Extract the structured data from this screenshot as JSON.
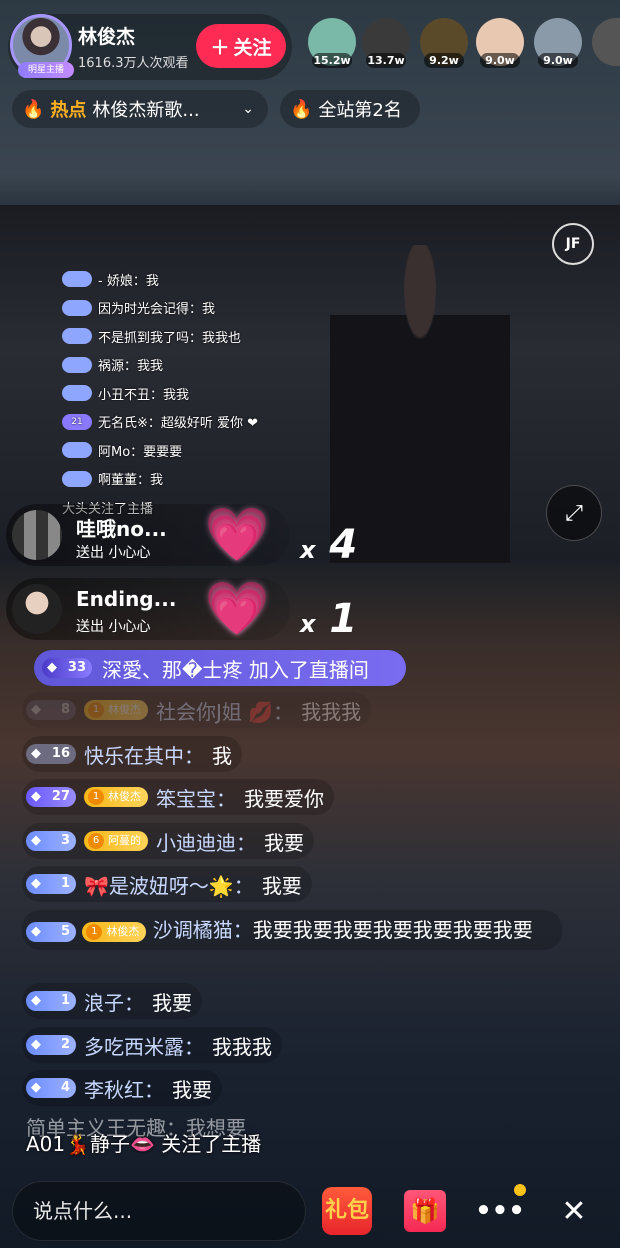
{
  "host": {
    "name": "林俊杰",
    "viewers": "1616.3万人次观看",
    "badge": "明星主播",
    "follow_label": "关注"
  },
  "top_viewers": [
    {
      "count": "15.2w",
      "color": "#7ab8a8"
    },
    {
      "count": "13.7w",
      "color": "#3a3a3a"
    },
    {
      "count": "9.2w",
      "color": "#5a4a2a"
    },
    {
      "count": "9.0w",
      "color": "#e8c8b0"
    },
    {
      "count": "9.0w",
      "color": "#8a9aa8"
    }
  ],
  "hot": {
    "label": "热点",
    "text": "林俊杰新歌..."
  },
  "rank": {
    "text": "全站第2名"
  },
  "video": {
    "logo": "JF",
    "chat": [
      {
        "level": "",
        "text": "- 娇娘：我"
      },
      {
        "level": "",
        "text": "因为时光会记得：我"
      },
      {
        "level": "",
        "text": "不是抓到我了吗：我我也"
      },
      {
        "level": "",
        "text": "祸源：我我"
      },
      {
        "level": "",
        "text": "小丑不丑：我我"
      },
      {
        "level": "21",
        "text": "无名氏※：超级好听 爱你 ❤"
      },
      {
        "level": "",
        "text": "阿Mo：要要要"
      },
      {
        "level": "",
        "text": "啊董董：我"
      },
      {
        "level": "",
        "text": "大头关注了主播"
      }
    ]
  },
  "gifts": [
    {
      "user": "哇哦no...",
      "sent": "送出 小心心",
      "x": "x",
      "count": "4"
    },
    {
      "user": "Ending...",
      "sent": "送出 小心心",
      "x": "x",
      "count": "1"
    }
  ],
  "join": {
    "level": "33",
    "text": "深愛、那�士疼 加入了直播间"
  },
  "chat": [
    {
      "level": "8",
      "fan": "1",
      "fan_name": "林俊杰",
      "nick": "社会你J姐 💋：",
      "msg": "我我我"
    },
    {
      "level": "16",
      "nick": "快乐在其中：",
      "msg": "我"
    },
    {
      "level": "27",
      "fan": "1",
      "fan_name": "林俊杰",
      "nick": "笨宝宝：",
      "msg": "我要爱你"
    },
    {
      "level": "3",
      "fan": "6",
      "fan_name": "阿蔓的",
      "nick": "小迪迪迪：",
      "msg": "我要"
    },
    {
      "level": "1",
      "nick": "🎀是波妞呀～🌟：",
      "msg": "我要"
    },
    {
      "level": "5",
      "fan": "1",
      "fan_name": "林俊杰",
      "nick": "沙调橘猫：",
      "msg": "我要我要我要我要我要我要我要"
    },
    {
      "level": "1",
      "nick": "浪子：",
      "msg": "我要"
    },
    {
      "level": "2",
      "nick": "多吃西米露：",
      "msg": "我我我"
    },
    {
      "level": "4",
      "nick": "李秋红：",
      "msg": "我要"
    }
  ],
  "partial_line": "简单主义王无趣：我想要",
  "follow_note": "A01💃静子👄 关注了主播",
  "bottom": {
    "placeholder": "说点什么...",
    "redpack_label": "礼包",
    "more_label": "•••",
    "close_label": "✕"
  }
}
